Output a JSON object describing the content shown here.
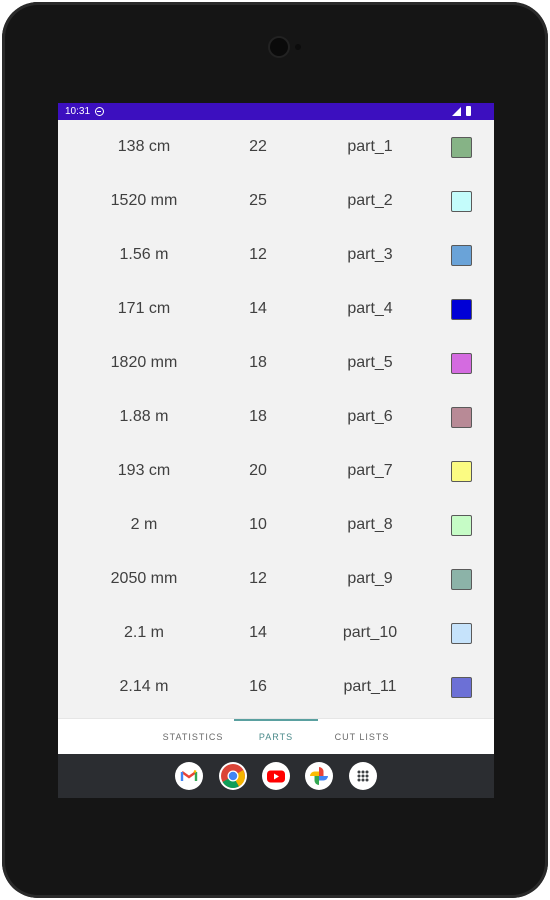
{
  "status_bar": {
    "time": "10:31"
  },
  "parts": [
    {
      "length": "138 cm",
      "quantity": "22",
      "name": "part_1",
      "color": "#86b386"
    },
    {
      "length": "1520 mm",
      "quantity": "25",
      "name": "part_2",
      "color": "#c4fcfb"
    },
    {
      "length": "1.56 m",
      "quantity": "12",
      "name": "part_3",
      "color": "#6aa3d8"
    },
    {
      "length": "171 cm",
      "quantity": "14",
      "name": "part_4",
      "color": "#0000d6"
    },
    {
      "length": "1820 mm",
      "quantity": "18",
      "name": "part_5",
      "color": "#d46be0"
    },
    {
      "length": "1.88 m",
      "quantity": "18",
      "name": "part_6",
      "color": "#b88a96"
    },
    {
      "length": "193 cm",
      "quantity": "20",
      "name": "part_7",
      "color": "#fbfb82"
    },
    {
      "length": "2 m",
      "quantity": "10",
      "name": "part_8",
      "color": "#c6fcc6"
    },
    {
      "length": "2050 mm",
      "quantity": "12",
      "name": "part_9",
      "color": "#8cb3a8"
    },
    {
      "length": "2.1 m",
      "quantity": "14",
      "name": "part_10",
      "color": "#c6e3fb"
    },
    {
      "length": "2.14 m",
      "quantity": "16",
      "name": "part_11",
      "color": "#6c70d6"
    }
  ],
  "tabs": [
    {
      "label": "STATISTICS",
      "selected": false
    },
    {
      "label": "PARTS",
      "selected": true
    },
    {
      "label": "CUT LISTS",
      "selected": false
    }
  ],
  "taskbar_apps": [
    "gmail-icon",
    "chrome-icon",
    "youtube-icon",
    "photos-icon",
    "app-drawer-icon"
  ]
}
